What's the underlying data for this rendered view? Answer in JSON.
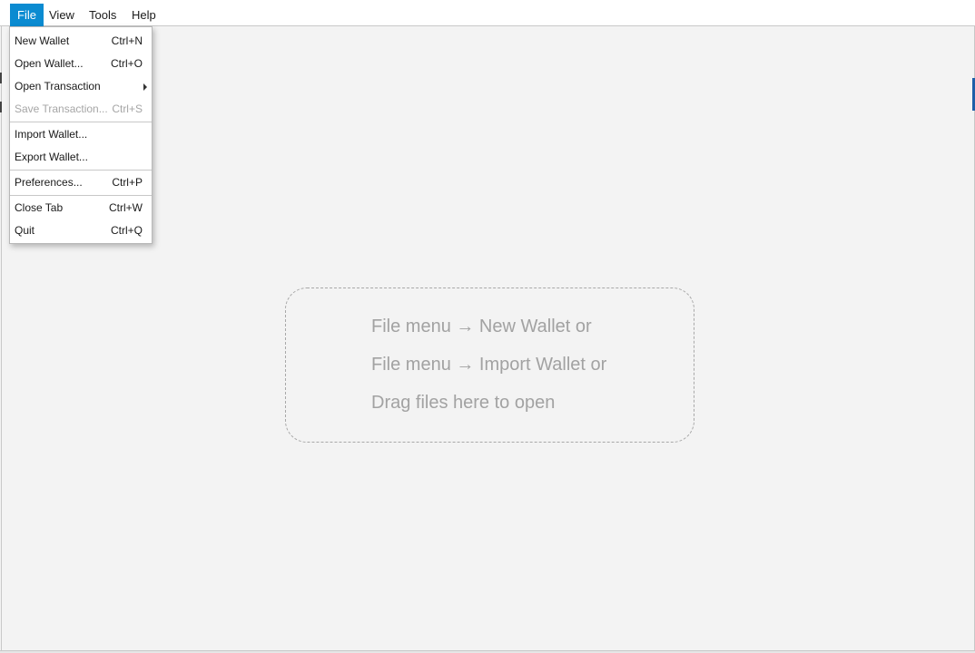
{
  "menubar": {
    "items": [
      {
        "label": "File"
      },
      {
        "label": "View"
      },
      {
        "label": "Tools"
      },
      {
        "label": "Help"
      }
    ]
  },
  "file_menu": {
    "items": [
      {
        "label": "New Wallet",
        "shortcut": "Ctrl+N"
      },
      {
        "label": "Open Wallet...",
        "shortcut": "Ctrl+O"
      },
      {
        "label": "Open Transaction",
        "shortcut": ""
      },
      {
        "label": "Save Transaction...",
        "shortcut": "Ctrl+S",
        "disabled": true
      },
      {
        "label": "Import Wallet...",
        "shortcut": ""
      },
      {
        "label": "Export Wallet...",
        "shortcut": ""
      },
      {
        "label": "Preferences...",
        "shortcut": "Ctrl+P"
      },
      {
        "label": "Close Tab",
        "shortcut": "Ctrl+W"
      },
      {
        "label": "Quit",
        "shortcut": "Ctrl+Q"
      }
    ]
  },
  "drop_zone": {
    "lines": [
      "File menu → New Wallet or",
      "File menu → Import Wallet or",
      "Drag files here to open"
    ]
  },
  "colors": {
    "menu_active_bg": "#0b8bd1",
    "window_bg": "#f3f3f3",
    "drop_text": "#a2a2a2",
    "disabled_text": "#a6a6a6"
  }
}
